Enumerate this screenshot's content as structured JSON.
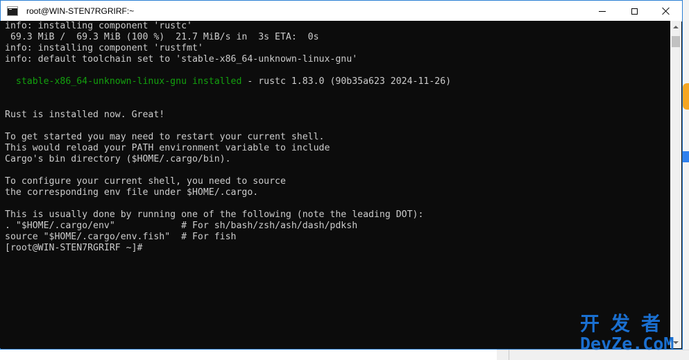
{
  "window": {
    "title": "root@WIN-STEN7RGRIRF:~",
    "buttons": {
      "minimize": "minimize",
      "maximize": "maximize",
      "close": "close"
    }
  },
  "console": {
    "lines": [
      "info: installing component 'rustc'",
      " 69.3 MiB /  69.3 MiB (100 %)  21.7 MiB/s in  3s ETA:  0s",
      "info: installing component 'rustfmt'",
      "info: default toolchain set to 'stable-x86_64-unknown-linux-gnu'",
      "",
      "",
      "",
      "",
      "Rust is installed now. Great!",
      "",
      "To get started you may need to restart your current shell.",
      "This would reload your PATH environment variable to include",
      "Cargo's bin directory ($HOME/.cargo/bin).",
      "",
      "To configure your current shell, you need to source",
      "the corresponding env file under $HOME/.cargo.",
      "",
      "This is usually done by running one of the following (note the leading DOT):",
      ". \"$HOME/.cargo/env\"            # For sh/bash/zsh/ash/dash/pdksh",
      "source \"$HOME/.cargo/env.fish\"  # For fish",
      "[root@WIN-STEN7RGRIRF ~]#"
    ],
    "installed_line": {
      "green": "  stable-x86_64-unknown-linux-gnu installed",
      "rest": " - rustc 1.83.0 (90b35a623 2024-11-26)"
    }
  },
  "colors": {
    "console_bg": "#0c0c0c",
    "console_fg": "#cccccc",
    "success_green": "#13a10e",
    "watermark_blue": "#1a6fd0"
  },
  "watermark": {
    "cn": "开发者",
    "en": "DevZe.CoM"
  }
}
